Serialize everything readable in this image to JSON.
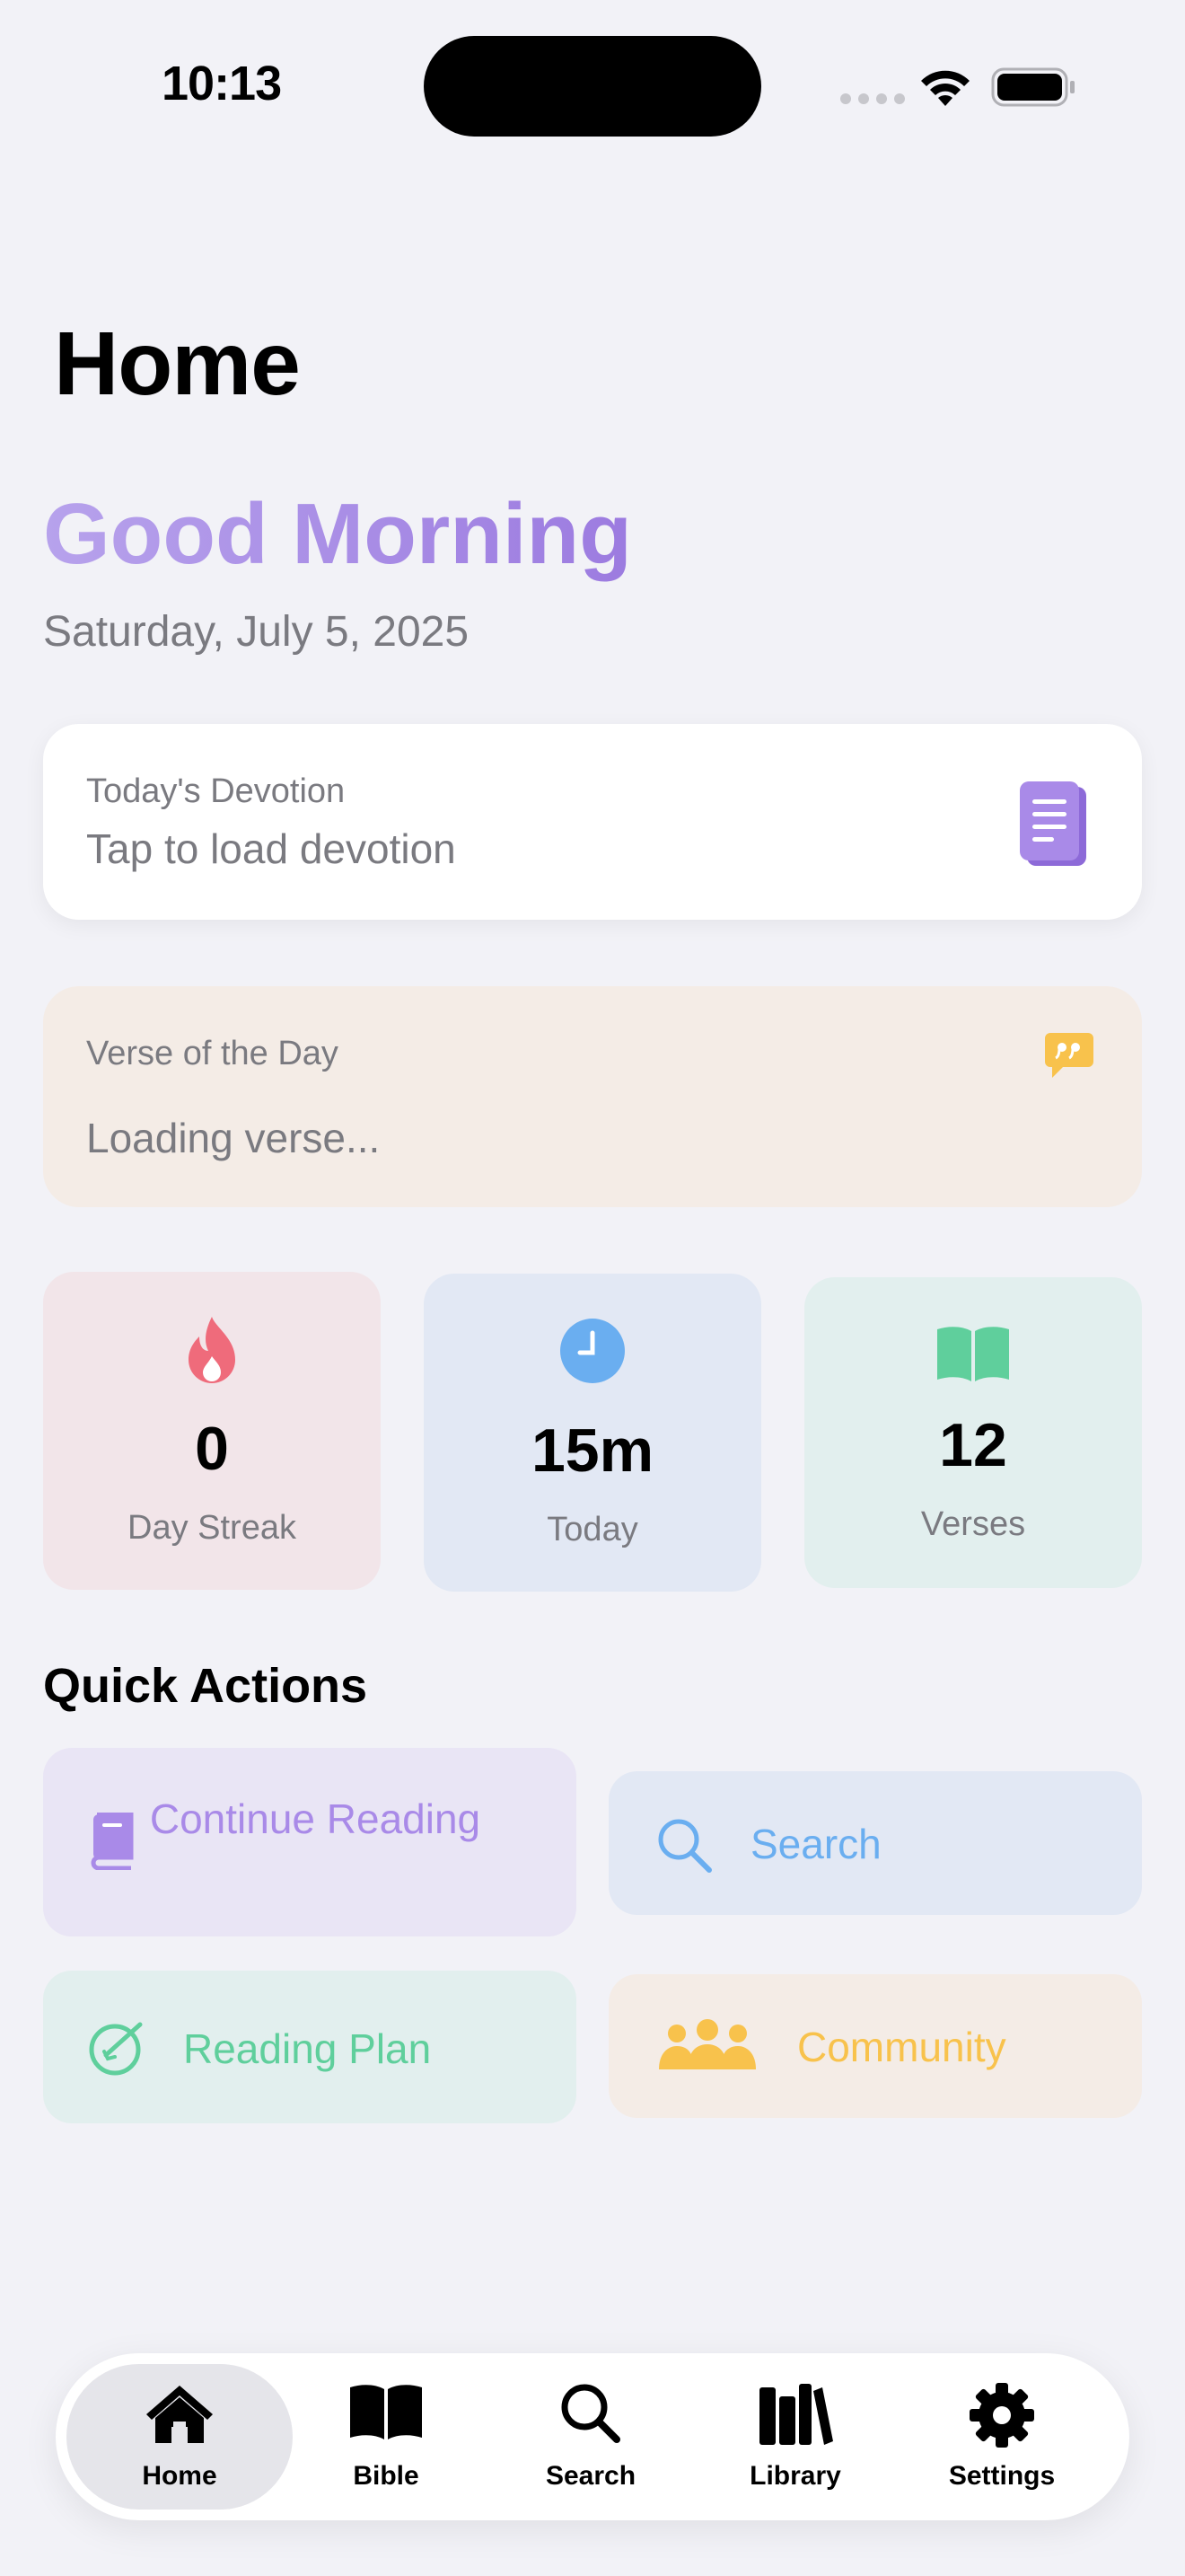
{
  "status_bar": {
    "time": "10:13"
  },
  "header": {
    "title": "Home",
    "greeting": "Good Morning",
    "date": "Saturday, July 5, 2025"
  },
  "devotion": {
    "label": "Today's Devotion",
    "body": "Tap to load devotion",
    "icon": "document-icon"
  },
  "verse": {
    "label": "Verse of the Day",
    "body": "Loading verse...",
    "icon": "quote-bubble-icon"
  },
  "stats": [
    {
      "value": "0",
      "label": "Day Streak",
      "icon": "flame-icon",
      "color": "#ef6b7b"
    },
    {
      "value": "15m",
      "label": "Today",
      "icon": "clock-icon",
      "color": "#6aaef0"
    },
    {
      "value": "12",
      "label": "Verses",
      "icon": "open-book-icon",
      "color": "#5fcf9c"
    }
  ],
  "quick_actions": {
    "title": "Quick Actions",
    "items": [
      {
        "label": "Continue Reading",
        "icon": "book-icon",
        "color": "#a98ae8"
      },
      {
        "label": "Search",
        "icon": "search-icon",
        "color": "#6aaef0"
      },
      {
        "label": "Reading Plan",
        "icon": "plan-check-icon",
        "color": "#5fcf9c"
      },
      {
        "label": "Community",
        "icon": "people-icon",
        "color": "#f8c24c"
      }
    ]
  },
  "tab_bar": {
    "active": "Home",
    "items": [
      {
        "label": "Home",
        "icon": "house-icon"
      },
      {
        "label": "Bible",
        "icon": "open-book-icon"
      },
      {
        "label": "Search",
        "icon": "search-icon"
      },
      {
        "label": "Library",
        "icon": "books-icon"
      },
      {
        "label": "Settings",
        "icon": "gear-icon"
      }
    ]
  }
}
